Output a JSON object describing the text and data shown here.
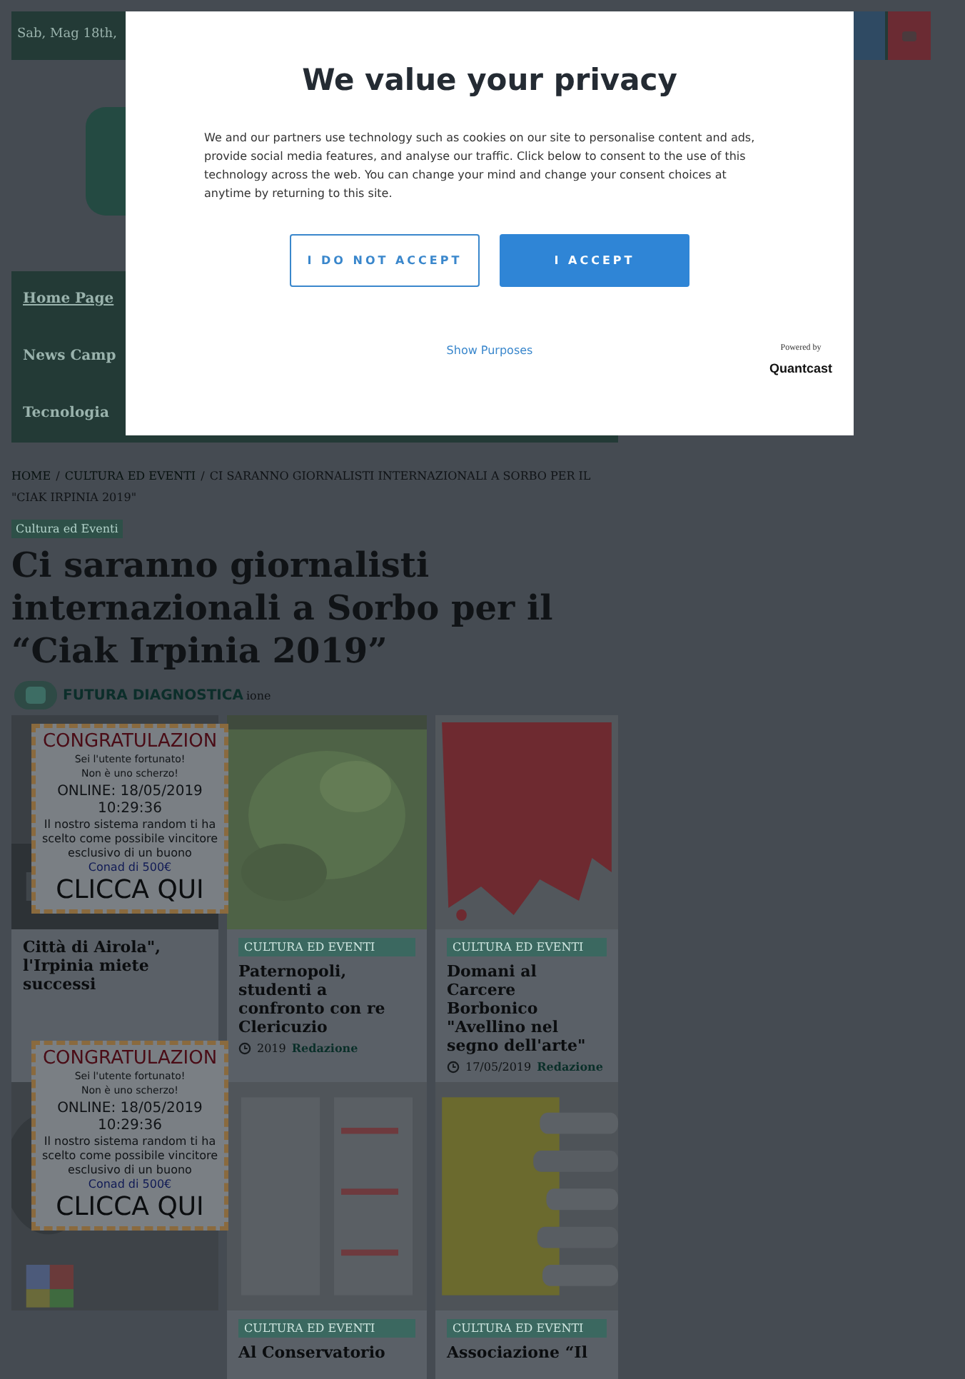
{
  "top_bar": {
    "date": "Sab, Mag 18th,"
  },
  "nav": {
    "items": [
      {
        "label": "Home Page",
        "selected": true
      },
      {
        "label": "News Camp",
        "selected": false
      },
      {
        "label": "Tecnologia",
        "selected": false
      }
    ]
  },
  "breadcrumb": [
    {
      "label": "HOME",
      "kind": "link"
    },
    {
      "label": "/",
      "kind": "separator"
    },
    {
      "label": "CULTURA ED EVENTI",
      "kind": "link"
    },
    {
      "label": "/",
      "kind": "separator"
    },
    {
      "label": "CI SARANNO GIORNALISTI INTERNAZIONALI A SORBO PER IL \"CIAK IRPINIA 2019\"",
      "kind": "current"
    }
  ],
  "article": {
    "category": "Cultura ed Eventi",
    "title": "Ci saranno giornalisti internazionali a Sorbo per il “Ciak Irpinia 2019”",
    "sponsor": "FUTURA DIAGNOSTICA",
    "byline_fragment": "ione"
  },
  "cards": [
    {
      "title": "Città di Airola\", l'Irpinia miete successi"
    },
    {
      "category": "CULTURA ED EVENTI",
      "title": "Paternopoli, studenti a confronto con re Clericuzio",
      "date": "2019",
      "author": "Redazione"
    },
    {
      "category": "CULTURA ED EVENTI",
      "title": "Domani al Carcere Borbonico \"Avellino nel segno dell'arte\"",
      "date": "17/05/2019",
      "author": "Redazione"
    },
    {
      "category": "CULTURA ED EVENTI",
      "title": "Al Conservatorio"
    },
    {
      "category": "CULTURA ED EVENTI",
      "title": "Associazione “Il"
    }
  ],
  "ads": [
    {
      "heading": "CONGRATULAZION",
      "lines": [
        "Sei l'utente fortunato!",
        "Non è uno scherzo!"
      ],
      "online": "ONLINE: 18/05/2019 10:29:36",
      "message": "Il nostro sistema random ti ha scelto come possibile vincitore esclusivo di un buono",
      "prize": "Conad di 500€",
      "cta": "CLICCA QUI"
    },
    {
      "heading": "CONGRATULAZION",
      "lines": [
        "Sei l'utente fortunato!",
        "Non è uno scherzo!"
      ],
      "online": "ONLINE: 18/05/2019 10:29:36",
      "message": "Il nostro sistema random ti ha scelto come possibile vincitore esclusivo di un buono",
      "prize": "Conad di 500€",
      "cta": "CLICCA QUI"
    }
  ],
  "consent": {
    "title": "We value your privacy",
    "text": "We and our partners use technology such as cookies on our site to personalise content and ads, provide social media features, and analyse our traffic. Click below to consent to the use of this technology across the web. You can change your mind and change your consent choices at anytime by returning to this site.",
    "buttons": [
      {
        "label": "I DO NOT ACCEPT",
        "kind": "outline"
      },
      {
        "label": "I ACCEPT",
        "kind": "primary"
      }
    ],
    "link": "Show Purposes",
    "powered_by": "Powered by",
    "brand": "Quantcast"
  }
}
